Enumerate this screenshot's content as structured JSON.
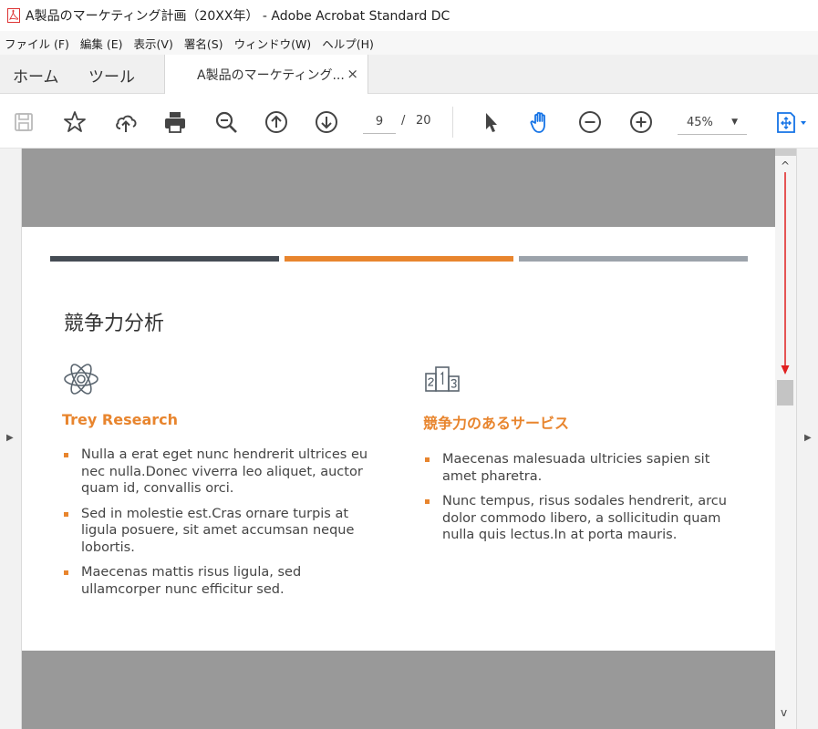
{
  "window": {
    "title": "A製品のマーケティング計画（20XX年） - Adobe Acrobat Standard DC"
  },
  "menu": [
    "ファイル (F)",
    "編集 (E)",
    "表示(V)",
    "署名(S)",
    "ウィンドウ(W)",
    "ヘルプ(H)"
  ],
  "tabs": {
    "home": "ホーム",
    "tools": "ツール",
    "document": "A製品のマーケティング...",
    "close": "×"
  },
  "toolbar": {
    "icons": [
      "save-icon",
      "star-icon",
      "upload-cloud-icon",
      "print-icon",
      "search-zoom-icon",
      "page-up-icon",
      "page-down-icon",
      "select-cursor-icon",
      "hand-icon",
      "zoom-out-icon",
      "zoom-in-icon",
      "fit-page-icon"
    ],
    "current_page": "9",
    "page_sep": "/",
    "total_pages": "20",
    "zoom": "45%",
    "accent_color": "#1473e6"
  },
  "slide": {
    "title": "競争力分析",
    "bar_colors": [
      "#454c54",
      "#e8852e",
      "#9ca3ab"
    ],
    "left": {
      "heading": "Trey Research",
      "bullets": [
        "Nulla a erat eget nunc hendrerit ultrices eu nec nulla.Donec viverra leo aliquet, auctor quam id, convallis orci.",
        "Sed in molestie est.Cras ornare turpis at ligula posuere, sit amet accumsan neque lobortis.",
        "Maecenas mattis risus ligula, sed ullamcorper nunc efficitur sed."
      ]
    },
    "right": {
      "heading": "競争力のあるサービス",
      "bullets": [
        "Maecenas malesuada ultricies sapien sit amet pharetra.",
        "Nunc tempus, risus sodales hendrerit, arcu dolor commodo libero, a sollicitudin quam nulla quis lectus.In at porta mauris."
      ]
    }
  },
  "colors": {
    "heading_orange": "#e8852e",
    "annotation_arrow": "#e02020"
  }
}
